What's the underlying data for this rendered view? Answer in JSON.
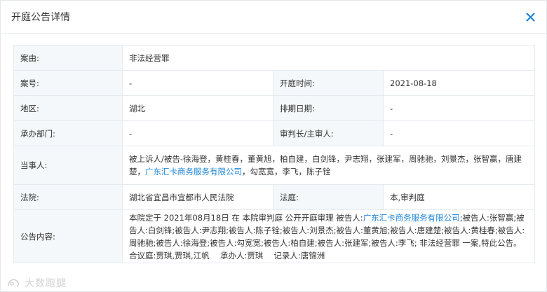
{
  "modal": {
    "title": "开庭公告详情",
    "close_icon": "close-icon",
    "accent_color": "#1f86d8"
  },
  "details": {
    "case_reason_label": "案由:",
    "case_reason_value": "非法经营罪",
    "case_no_label": "案号:",
    "case_no_value": "-",
    "hearing_time_label": "开庭时间:",
    "hearing_time_value": "2021-08-18",
    "region_label": "地区:",
    "region_value": "湖北",
    "schedule_date_label": "排期日期:",
    "schedule_date_value": "-",
    "department_label": "承办部门:",
    "department_value": "-",
    "judge_label": "审判长/主审人:",
    "judge_value": "-",
    "parties_label": "当事人:",
    "parties_text_1": "被上诉人/被告-徐海登，黄桂春，董黄旭，柏自建，白剑锋，尹志翔，张建军，周驰驰，刘景杰，张智赢，唐建楚，",
    "parties_link": "广东汇卡商务服务有限公司",
    "parties_text_2": "，勾宽宽，李飞，陈子铨",
    "court_label": "法院:",
    "court_value": "湖北省宜昌市宜都市人民法院",
    "tribunal_label": "法庭:",
    "tribunal_value": "本,审判庭",
    "notice_label": "公告内容:",
    "notice_text_1": "本院定于 2021年08月18日 在 本院审判庭 公开开庭审理 被告人:",
    "notice_link": "广东汇卡商务服务有限公司",
    "notice_text_2": ";被告人:张智赢;被告人:白剑锋;被告人:尹志翔;被告人:陈子铨;被告人:刘景杰;被告人:董黄旭;被告人:唐建楚;被告人:黄桂春;被告人:周驰驰;被告人:徐海登;被告人:勾宽宽;被告人:柏自建;被告人:张建军;被告人:李飞; 非法经营罪 一案,特此公告。　 合议庭:贾琪,贾琪,江帆　 承办人:贾琪　 记录人:唐锦洲"
  },
  "watermark": {
    "text": "大数跑腿"
  }
}
